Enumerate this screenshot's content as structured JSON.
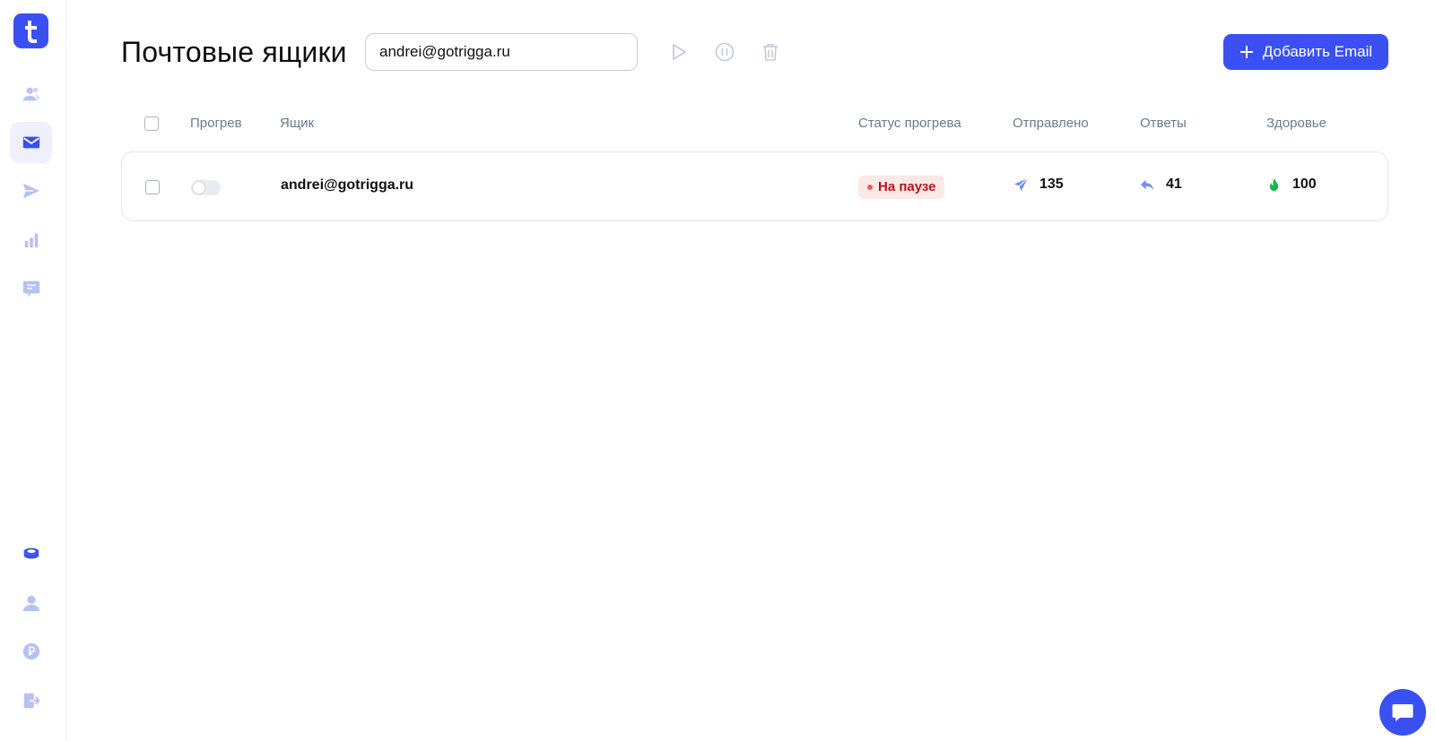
{
  "app": {
    "logo_letter": "t",
    "accent": "#3a50f2"
  },
  "sidebar": {
    "top_items": [
      {
        "icon": "users-icon",
        "active": false
      },
      {
        "icon": "mail-icon",
        "active": true
      },
      {
        "icon": "send-icon",
        "active": false
      },
      {
        "icon": "bar-chart-icon",
        "active": false
      },
      {
        "icon": "chat-icon",
        "active": false
      }
    ],
    "bottom_items": [
      {
        "icon": "coins-icon"
      },
      {
        "icon": "user-icon"
      },
      {
        "icon": "ruble-icon"
      },
      {
        "icon": "logout-icon"
      }
    ]
  },
  "header": {
    "title": "Почтовые ящики",
    "search_value": "andrei@gotrigga.ru",
    "add_button_label": "Добавить Email"
  },
  "table": {
    "columns": {
      "warmup": "Прогрев",
      "mailbox": "Ящик",
      "warmup_status": "Статус прогрева",
      "sent": "Отправлено",
      "replies": "Ответы",
      "health": "Здоровье"
    },
    "rows": [
      {
        "email": "andrei@gotrigga.ru",
        "warmup_on": false,
        "status": "На паузе",
        "sent": "135",
        "replies": "41",
        "health": "100"
      }
    ]
  },
  "colors": {
    "status_paused_bg": "#fde8e8",
    "status_paused_text": "#b8131b",
    "health_green": "#1fb34a",
    "muted_icon": "#c4c9da",
    "sidebar_icon": "#b7c2f2"
  }
}
